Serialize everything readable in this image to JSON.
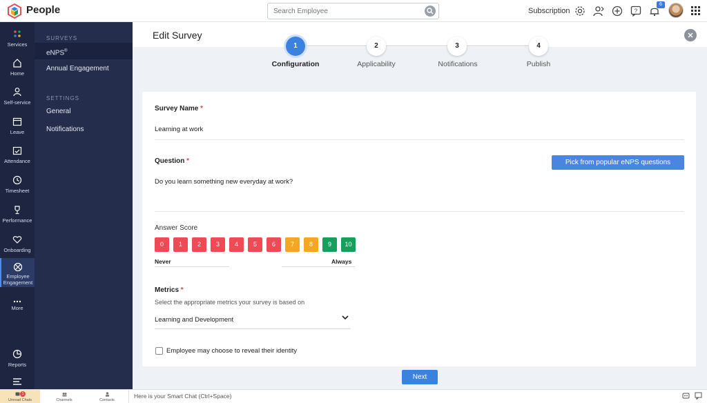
{
  "app": {
    "brand": "People",
    "colors": {
      "accent": "#3b82e0",
      "rail": "#1d2540",
      "subnav": "#252d4d"
    }
  },
  "topbar": {
    "search_placeholder": "Search Employee",
    "subscription": "Subscription",
    "notification_count": "6",
    "icons": [
      "settings-icon",
      "user-switch-icon",
      "add-icon",
      "help-icon",
      "bell-icon",
      "apps-grid-icon"
    ]
  },
  "rail": {
    "items": [
      {
        "label": "Services",
        "icon": "services-icon"
      },
      {
        "label": "Home",
        "icon": "home-icon"
      },
      {
        "label": "Self-service",
        "icon": "person-icon"
      },
      {
        "label": "Leave",
        "icon": "calendar-icon"
      },
      {
        "label": "Attendance",
        "icon": "attendance-icon"
      },
      {
        "label": "Timesheet",
        "icon": "clock-icon"
      },
      {
        "label": "Performance",
        "icon": "trophy-icon"
      },
      {
        "label": "Onboarding",
        "icon": "onboarding-icon"
      },
      {
        "label": "Employee Engagement",
        "icon": "engagement-icon"
      },
      {
        "label": "More",
        "icon": "more-icon"
      },
      {
        "label": "Reports",
        "icon": "reports-icon"
      }
    ]
  },
  "subnav": {
    "surveys_heading": "SURVEYS",
    "enps_label": "eNPS",
    "enps_sup": "®",
    "annual_label": "Annual Engagement",
    "settings_heading": "SETTINGS",
    "general_label": "General",
    "notifications_label": "Notifications"
  },
  "page": {
    "title": "Edit Survey"
  },
  "stepper": {
    "steps": [
      {
        "num": "1",
        "label": "Configuration"
      },
      {
        "num": "2",
        "label": "Applicability"
      },
      {
        "num": "3",
        "label": "Notifications"
      },
      {
        "num": "4",
        "label": "Publish"
      }
    ]
  },
  "form": {
    "survey_name_label": "Survey Name",
    "survey_name_value": "Learning at work",
    "question_label": "Question",
    "question_value": "Do you learn something new everyday at work?",
    "pick_button": "Pick from popular eNPS questions",
    "answer_score_label": "Answer Score",
    "scores": [
      "0",
      "1",
      "2",
      "3",
      "4",
      "5",
      "6",
      "7",
      "8",
      "9",
      "10"
    ],
    "score_colors": {
      "detractor": "#ef4a55",
      "passive": "#f5a623",
      "promoter": "#17a05d"
    },
    "never_label": "Never",
    "always_label": "Always",
    "metrics_label": "Metrics",
    "metrics_hint": "Select the appropriate metrics your survey is based on",
    "metrics_value": "Learning and Development",
    "reveal_identity_label": "Employee may choose to reveal their identity",
    "required_mark": "*"
  },
  "actions": {
    "next": "Next"
  },
  "bottombar": {
    "unread_chats": "Unread Chats",
    "unread_count": "1",
    "channels": "Channels",
    "contacts": "Contacts",
    "smart_chat": "Here is your Smart Chat (Ctrl+Space)"
  }
}
